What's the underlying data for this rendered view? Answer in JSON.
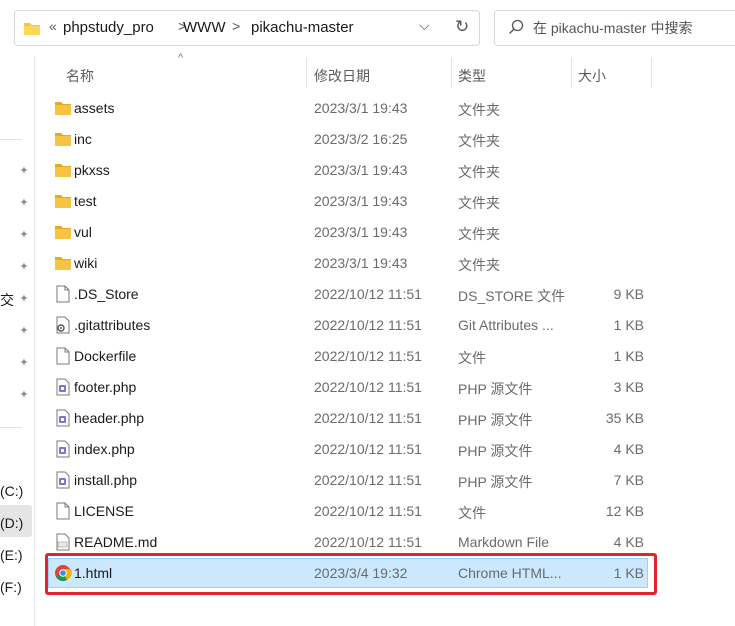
{
  "address": {
    "overflow_label": "«",
    "breadcrumbs": [
      "phpstudy_pro",
      "WWW",
      "pikachu-master"
    ],
    "separator": ">",
    "dropdown_glyph": "⌵",
    "refresh_glyph": "↻"
  },
  "search": {
    "placeholder": "在 pikachu-master 中搜索"
  },
  "nav": {
    "partial_text": "交",
    "drives": [
      "(C:)",
      "(D:)",
      "(E:)",
      "(F:)"
    ]
  },
  "columns": {
    "name": "名称",
    "date": "修改日期",
    "type": "类型",
    "size": "大小",
    "sort_glyph": "^"
  },
  "files": [
    {
      "name": "assets",
      "date": "2023/3/1 19:43",
      "type": "文件夹",
      "size": "",
      "icon": "folder-icon"
    },
    {
      "name": "inc",
      "date": "2023/3/2 16:25",
      "type": "文件夹",
      "size": "",
      "icon": "folder-icon"
    },
    {
      "name": "pkxss",
      "date": "2023/3/1 19:43",
      "type": "文件夹",
      "size": "",
      "icon": "folder-icon"
    },
    {
      "name": "test",
      "date": "2023/3/1 19:43",
      "type": "文件夹",
      "size": "",
      "icon": "folder-icon"
    },
    {
      "name": "vul",
      "date": "2023/3/1 19:43",
      "type": "文件夹",
      "size": "",
      "icon": "folder-icon"
    },
    {
      "name": "wiki",
      "date": "2023/3/1 19:43",
      "type": "文件夹",
      "size": "",
      "icon": "folder-icon"
    },
    {
      "name": ".DS_Store",
      "date": "2022/10/12 11:51",
      "type": "DS_STORE 文件",
      "size": "9 KB",
      "icon": "file-icon"
    },
    {
      "name": ".gitattributes",
      "date": "2022/10/12 11:51",
      "type": "Git Attributes ...",
      "size": "1 KB",
      "icon": "settings-file-icon"
    },
    {
      "name": "Dockerfile",
      "date": "2022/10/12 11:51",
      "type": "文件",
      "size": "1 KB",
      "icon": "file-icon"
    },
    {
      "name": "footer.php",
      "date": "2022/10/12 11:51",
      "type": "PHP 源文件",
      "size": "3 KB",
      "icon": "php-file-icon"
    },
    {
      "name": "header.php",
      "date": "2022/10/12 11:51",
      "type": "PHP 源文件",
      "size": "35 KB",
      "icon": "php-file-icon"
    },
    {
      "name": "index.php",
      "date": "2022/10/12 11:51",
      "type": "PHP 源文件",
      "size": "4 KB",
      "icon": "php-file-icon"
    },
    {
      "name": "install.php",
      "date": "2022/10/12 11:51",
      "type": "PHP 源文件",
      "size": "7 KB",
      "icon": "php-file-icon"
    },
    {
      "name": "LICENSE",
      "date": "2022/10/12 11:51",
      "type": "文件",
      "size": "12 KB",
      "icon": "file-icon"
    },
    {
      "name": "README.md",
      "date": "2022/10/12 11:51",
      "type": "Markdown File",
      "size": "4 KB",
      "icon": "markdown-file-icon"
    },
    {
      "name": "1.html",
      "date": "2023/3/4 19:32",
      "type": "Chrome HTML...",
      "size": "1 KB",
      "icon": "chrome-icon",
      "selected": true
    }
  ],
  "colors": {
    "selection": "#cce8ff",
    "highlight_border": "#e0262b",
    "folder": "#f6c343"
  }
}
